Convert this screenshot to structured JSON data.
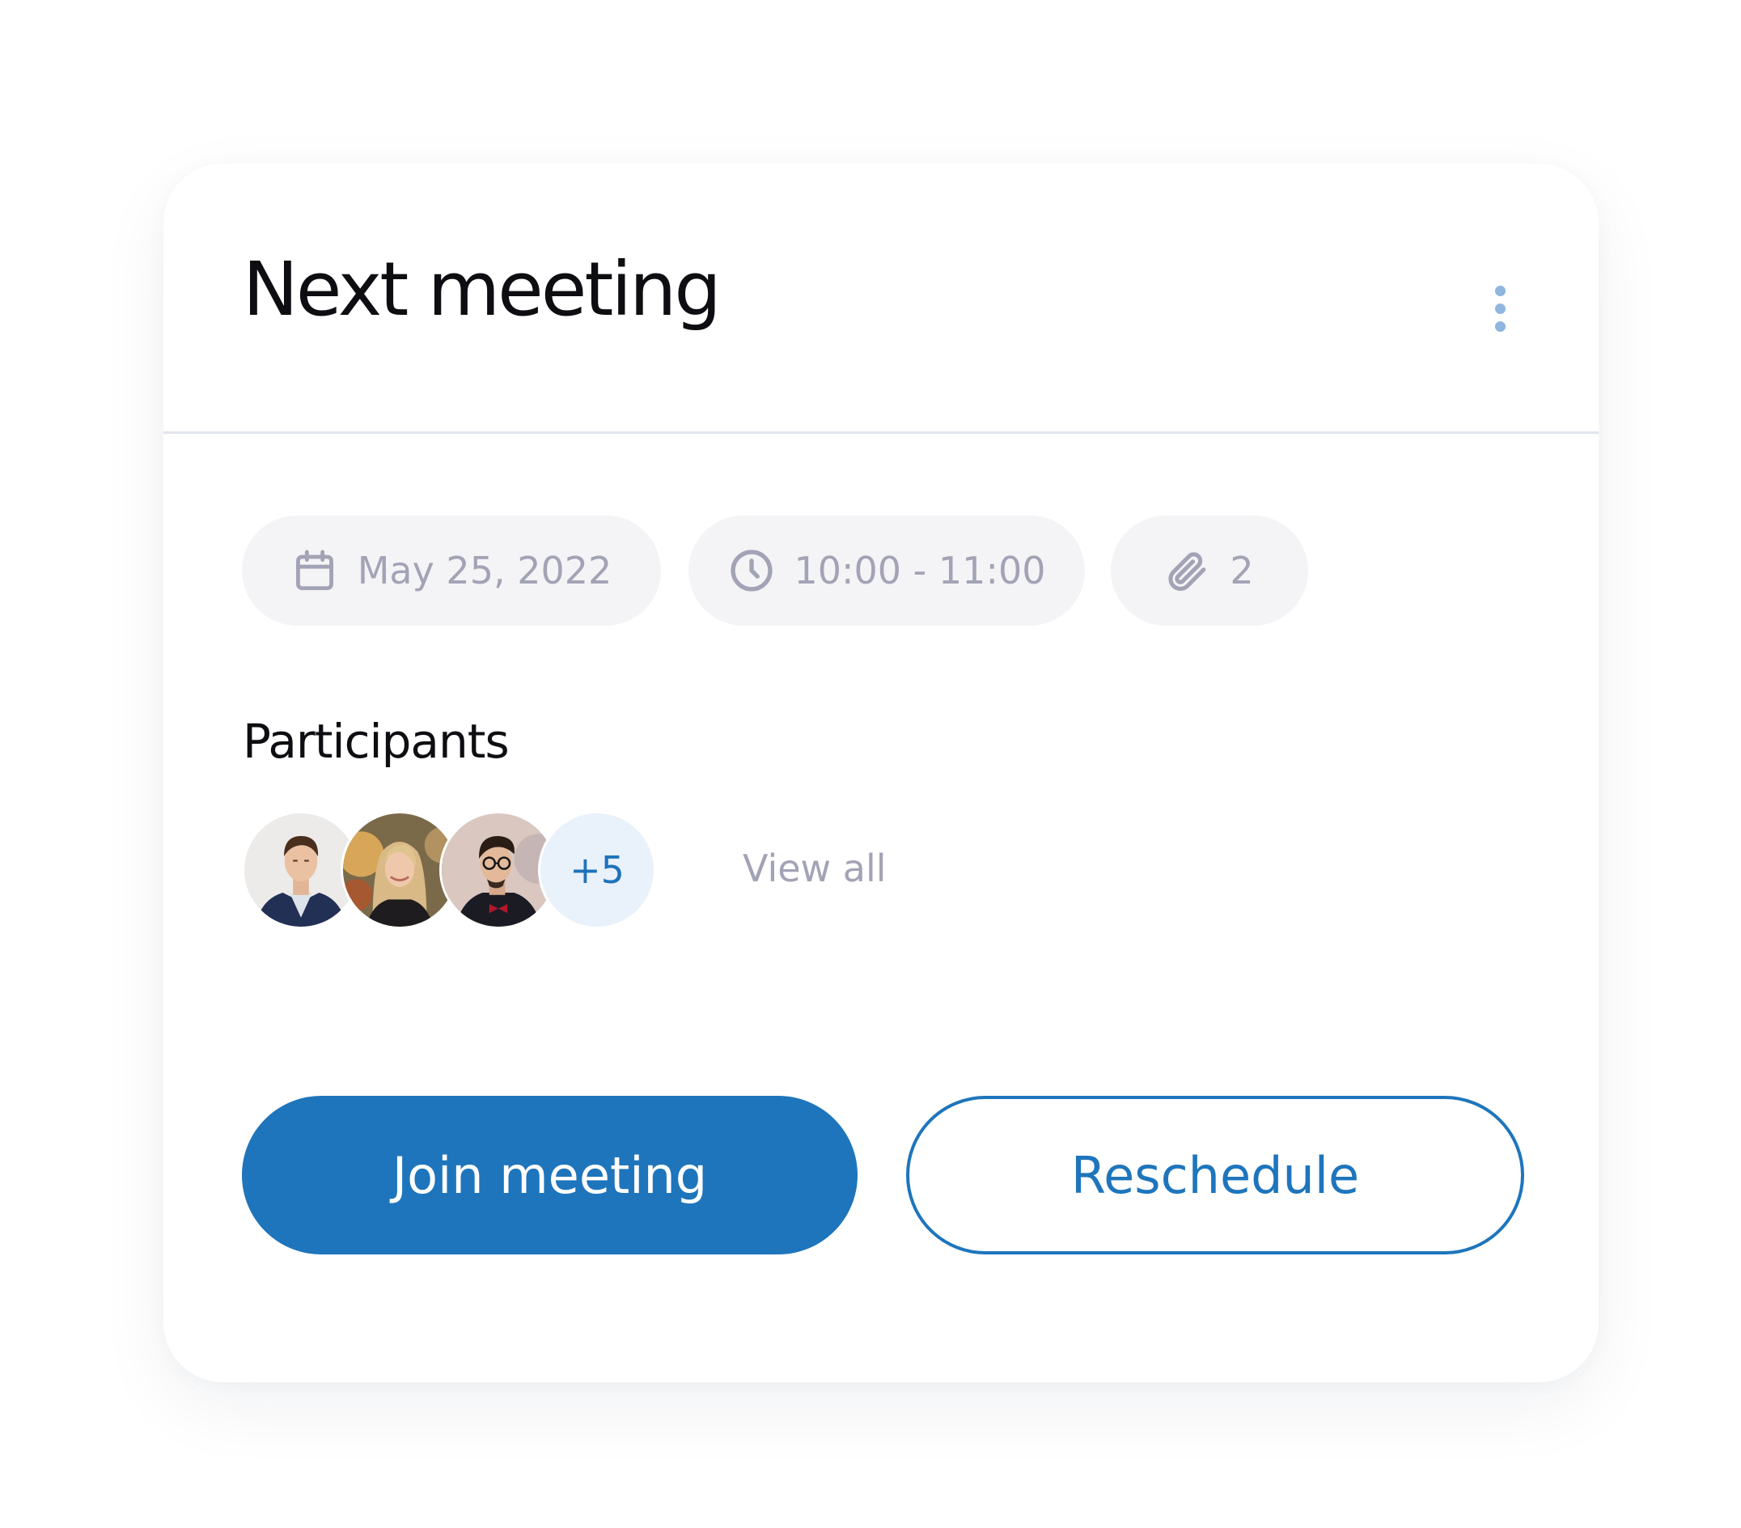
{
  "card": {
    "title": "Next meeting",
    "menu_icon": "more-vertical-icon"
  },
  "details": {
    "date": {
      "icon": "calendar-icon",
      "label": "May 25, 2022"
    },
    "time": {
      "icon": "clock-icon",
      "label": "10:00 - 11:00"
    },
    "attachments": {
      "icon": "paperclip-icon",
      "count": "2"
    }
  },
  "participants": {
    "heading": "Participants",
    "avatars": [
      {
        "description": "man-in-suit-avatar"
      },
      {
        "description": "blonde-woman-avatar"
      },
      {
        "description": "man-with-glasses-avatar"
      }
    ],
    "more_count": "+5",
    "view_all_label": "View all"
  },
  "actions": {
    "join_label": "Join meeting",
    "reschedule_label": "Reschedule"
  },
  "colors": {
    "primary": "#1e75bc",
    "chip_background": "#f4f4f6",
    "muted_text": "#a3a3b6",
    "kebab_dots": "#8fb6de",
    "more_badge_background": "#e9f1fa"
  }
}
